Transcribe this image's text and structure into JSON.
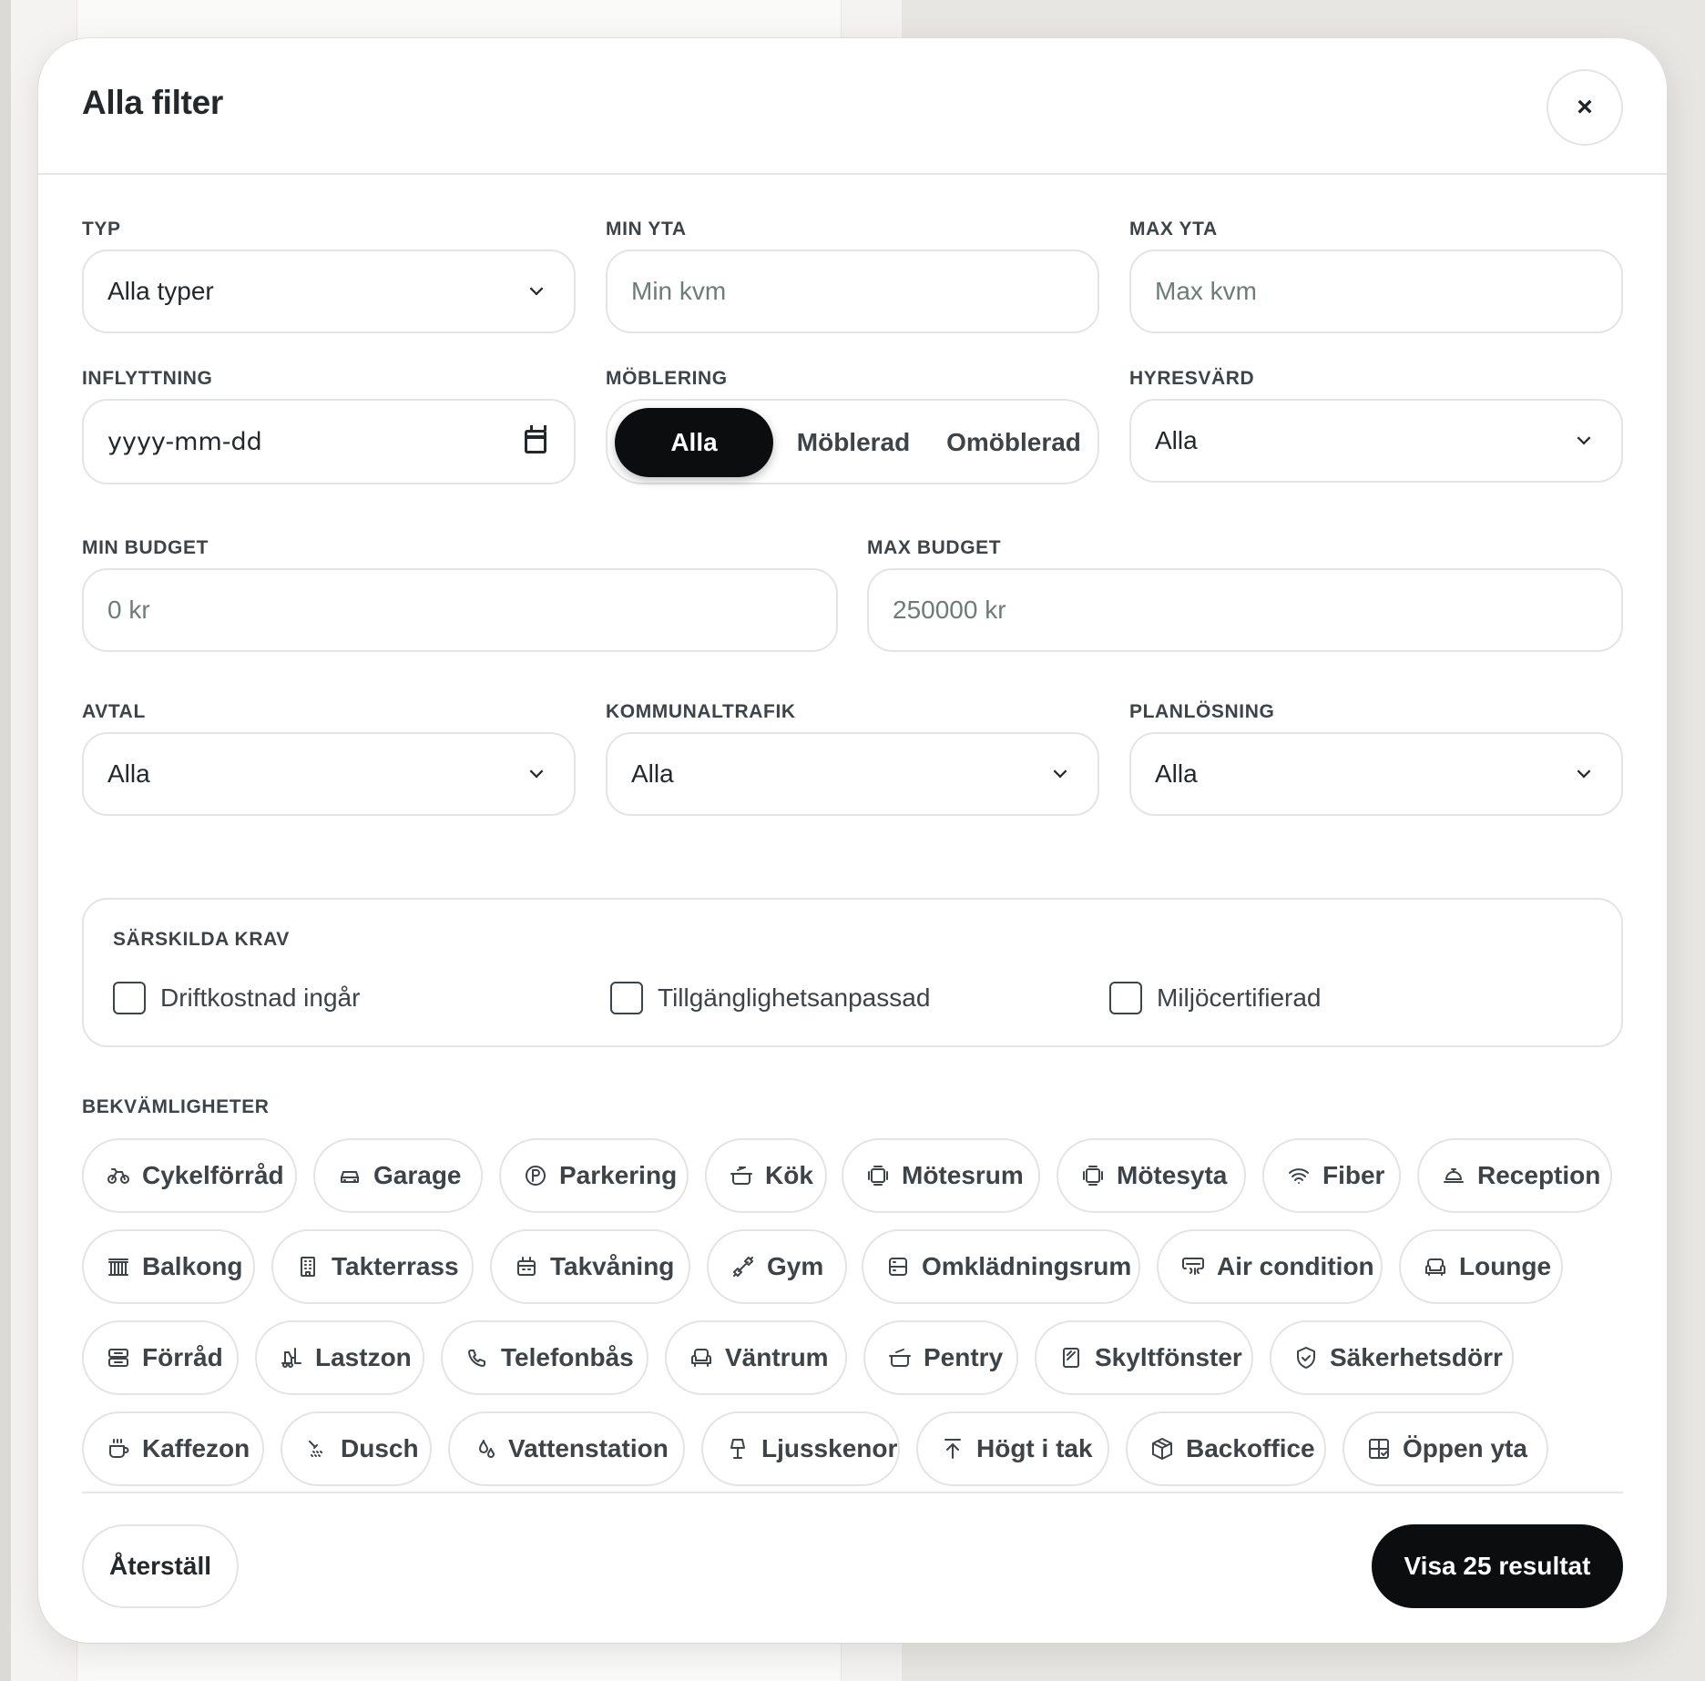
{
  "modal": {
    "title": "Alla filter",
    "close_label": "×"
  },
  "fields": {
    "typ": {
      "label": "TYP",
      "value": "Alla typer"
    },
    "min_yta": {
      "label": "MIN YTA",
      "placeholder": "Min kvm"
    },
    "max_yta": {
      "label": "MAX YTA",
      "placeholder": "Max kvm"
    },
    "inflyttning": {
      "label": "INFLYTTNING",
      "placeholder": "yyyy-mm-dd"
    },
    "moblering": {
      "label": "MÖBLERING",
      "options": [
        "Alla",
        "Möblerad",
        "Omöblerad"
      ],
      "selected": "Alla"
    },
    "hyresvard": {
      "label": "HYRESVÄRD",
      "value": "Alla"
    },
    "min_budget": {
      "label": "MIN BUDGET",
      "placeholder": "0 kr"
    },
    "max_budget": {
      "label": "MAX BUDGET",
      "placeholder": "250000 kr"
    },
    "avtal": {
      "label": "AVTAL",
      "value": "Alla"
    },
    "kommunaltrafik": {
      "label": "KOMMUNALTRAFIK",
      "value": "Alla"
    },
    "planlosning": {
      "label": "PLANLÖSNING",
      "value": "Alla"
    }
  },
  "requirements": {
    "label": "SÄRSKILDA KRAV",
    "items": [
      {
        "label": "Driftkostnad ingår",
        "checked": false
      },
      {
        "label": "Tillgänglighetsanpassad",
        "checked": false
      },
      {
        "label": "Miljöcertifierad",
        "checked": false
      }
    ]
  },
  "amenities": {
    "label": "BEKVÄMLIGHETER",
    "items": [
      {
        "label": "Cykelförråd",
        "icon": "bike-icon"
      },
      {
        "label": "Garage",
        "icon": "car-icon"
      },
      {
        "label": "Parkering",
        "icon": "parking-icon"
      },
      {
        "label": "Kök",
        "icon": "cooking-pot-icon"
      },
      {
        "label": "Mötesrum",
        "icon": "meeting-room-icon"
      },
      {
        "label": "Mötesyta",
        "icon": "meeting-area-icon"
      },
      {
        "label": "Fiber",
        "icon": "wifi-icon"
      },
      {
        "label": "Reception",
        "icon": "reception-bell-icon"
      },
      {
        "label": "Balkong",
        "icon": "balcony-icon"
      },
      {
        "label": "Takterrass",
        "icon": "building-icon"
      },
      {
        "label": "Takvåning",
        "icon": "penthouse-icon"
      },
      {
        "label": "Gym",
        "icon": "dumbbell-icon"
      },
      {
        "label": "Omklädningsrum",
        "icon": "locker-icon"
      },
      {
        "label": "Air condition",
        "icon": "air-vent-icon"
      },
      {
        "label": "Lounge",
        "icon": "sofa-icon"
      },
      {
        "label": "Förråd",
        "icon": "storage-icon"
      },
      {
        "label": "Lastzon",
        "icon": "forklift-icon"
      },
      {
        "label": "Telefonbås",
        "icon": "phone-icon"
      },
      {
        "label": "Väntrum",
        "icon": "armchair-icon"
      },
      {
        "label": "Pentry",
        "icon": "pot-icon"
      },
      {
        "label": "Skyltfönster",
        "icon": "sign-window-icon"
      },
      {
        "label": "Säkerhetsdörr",
        "icon": "shield-icon"
      },
      {
        "label": "Kaffezon",
        "icon": "coffee-icon"
      },
      {
        "label": "Dusch",
        "icon": "shower-icon"
      },
      {
        "label": "Vattenstation",
        "icon": "droplets-icon"
      },
      {
        "label": "Ljusskenor",
        "icon": "lamp-icon"
      },
      {
        "label": "Högt i tak",
        "icon": "arrow-up-to-line-icon"
      },
      {
        "label": "Backoffice",
        "icon": "package-icon"
      },
      {
        "label": "Öppen yta",
        "icon": "layout-grid-icon"
      }
    ]
  },
  "footer": {
    "reset_label": "Återställ",
    "submit_label": "Visa 25 resultat"
  },
  "colors": {
    "primary": "#0c0d0f",
    "border": "#e4e4e2",
    "text": "#24282b",
    "muted": "#3d4347",
    "placeholder": "#6f7b78"
  }
}
